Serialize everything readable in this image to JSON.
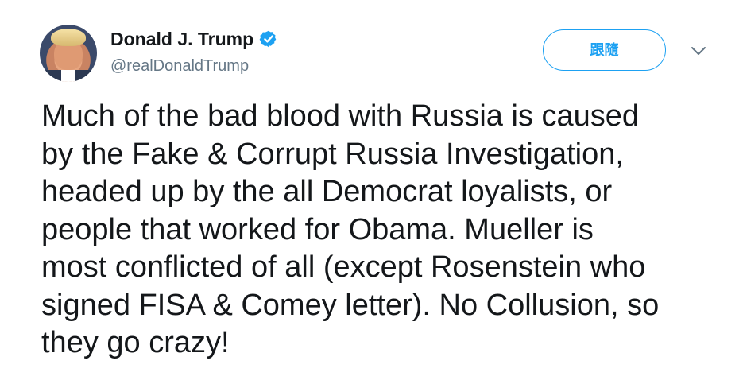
{
  "user": {
    "display_name": "Donald J. Trump",
    "handle": "@realDonaldTrump",
    "verified": true
  },
  "actions": {
    "follow_label": "跟隨",
    "menu_icon": "chevron-down-icon"
  },
  "tweet": {
    "text": "Much of the bad blood with Russia is caused\nby the Fake & Corrupt Russia Investigation,\nheaded up by the all Democrat loyalists, or\npeople that worked for Obama. Mueller is\nmost conflicted of all (except Rosenstein who\nsigned FISA & Comey letter). No Collusion, so\nthey go crazy!"
  },
  "colors": {
    "accent": "#1da1f2",
    "text": "#14171a",
    "muted": "#657786"
  }
}
